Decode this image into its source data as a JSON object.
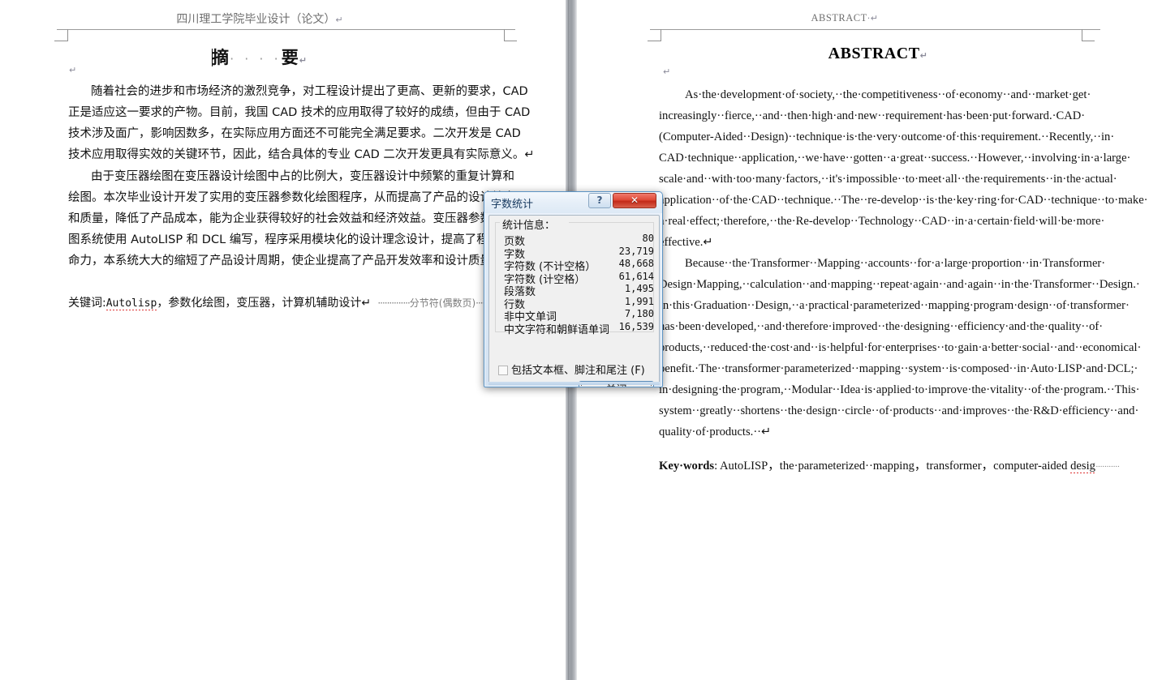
{
  "document": {
    "left_page": {
      "header": "四川理工学院毕业设计（论文）",
      "header_mark": "↵",
      "title": "摘",
      "title_dots": "· · · ·",
      "title_second": "要",
      "title_mark": "↵",
      "empty_para_mark": "↵",
      "paragraph_1_lines": [
        "随着社会的进步和市场经济的激烈竞争，对工程设计提出了更高、更新的要求，CAD",
        "正是适应这一要求的产物。目前，我国 CAD 技术的应用取得了较好的成绩，但由于 CAD",
        "技术涉及面广，影响因数多，在实际应用方面还不可能完全满足要求。二次开发是 CAD",
        "技术应用取得实效的关键环节，因此，结合具体的专业 CAD 二次开发更具有实际意义。↵"
      ],
      "paragraph_2_lines": [
        "由于变压器绘图在变压器设计绘图中占的比例大，变压器设计中频繁的重复计算和",
        "绘图。本次毕业设计开发了实用的变压器参数化绘图程序，从而提高了产品的设计效率",
        "和质量，降低了产品成本，能为企业获得较好的社会效益和经济效益。变压器参数化绘",
        "图系统使用 AutoLISP 和 DCL 编写，程序采用模块化的设计理念设计，提高了程序的生",
        "命力，本系统大大的缩短了产品设计周期，使企业提高了产品开发效率和设计质量。↵"
      ],
      "keywords_label": "关键词:",
      "keywords_first": "Autolisp",
      "keywords_rest": "，参数化绘图，变压器，计算机辅助设计↵",
      "section_break": "分节符(偶数页)",
      "section_break_dashes": "··············"
    },
    "right_page": {
      "header": "ABSTRACT",
      "header_mark": "·↵",
      "title": "ABSTRACT",
      "title_mark": "↵",
      "empty_para_mark": "↵",
      "paragraph_1_lines": [
        "As·the·development·of·society,··the·competitiveness··of·economy··and··market·get·",
        "increasingly··fierce,··and··then·high·and·new··requirement·has·been·put·forward.·CAD·",
        "(Computer-Aided··Design)··technique·is·the·very·outcome·of·this·requirement.··Recently,··in·",
        "CAD·technique··application,··we·have··gotten··a·great··success.··However,··involving·in·a·large·",
        "scale·and··with·too·many·factors,··it's·impossible··to·meet·all··the·requirements··in·the·actual·",
        "application··of·the·CAD··technique.··The··re-develop··is·the·key·ring·for·CAD··technique··to·make·",
        "a·real·effect;·therefore,··the·Re-develop··Technology··CAD··in·a·certain·field·will·be·more·",
        "effective.↵"
      ],
      "paragraph_2_lines": [
        "Because··the·Transformer··Mapping··accounts··for·a·large·proportion··in·Transformer·",
        "Design·Mapping,··calculation··and·mapping··repeat·again··and·again··in·the·Transformer··Design.·",
        "In·this·Graduation··Design,··a·practical·parameterized··mapping·program·design··of·transformer·",
        "has·been·developed,··and·therefore·improved··the·designing··efficiency·and·the·quality··of·",
        "products,··reduced·the·cost·and··is·helpful·for·enterprises··to·gain·a·better·social··and··economical·",
        "benefit.·The··transformer·parameterized··mapping··system··is·composed··in·Auto·LISP·and·DCL;·",
        "in·designing·the·program,··Modular··Idea·is·applied·to·improve·the·vitality··of·the·program.··This·",
        "system··greatly··shortens··the·design··circle··of·products··and·improves··the·R&D·efficiency··and·",
        "quality·of·products.··↵"
      ],
      "keywords_label": "Key·words",
      "keywords_value": ": AutoLISP，the·parameterized··mapping，transformer，computer-aided",
      "keywords_misspelled": "desig",
      "keywords_tail_dots": "···········"
    }
  },
  "dialog": {
    "title": "字数统计",
    "help_button": "?",
    "close_button_glyph": "✕",
    "group_label": "统计信息：",
    "stats": [
      {
        "label": "页数",
        "value": "80"
      },
      {
        "label": "字数",
        "value": "23,719"
      },
      {
        "label": "字符数 (不计空格）",
        "value": "48,668"
      },
      {
        "label": "字符数 (计空格）",
        "value": "61,614"
      },
      {
        "label": "段落数",
        "value": "1,495"
      },
      {
        "label": "行数",
        "value": "1,991"
      },
      {
        "label": "非中文单词",
        "value": "7,180"
      },
      {
        "label": "中文字符和朝鲜语单词",
        "value": "16,539"
      }
    ],
    "checkbox_label": "包括文本框、脚注和尾注 (F)",
    "checkbox_checked": false,
    "ok_button": "关闭",
    "accent_close_red": "#c32a19",
    "accent_border_blue": "#5b93c4"
  }
}
